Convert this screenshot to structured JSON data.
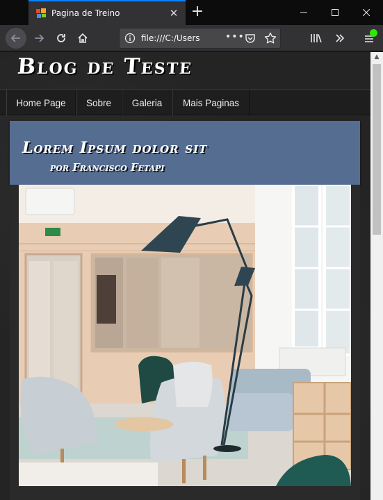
{
  "browser": {
    "tab_title": "Pagina de Treino",
    "url": "file:///C:/Users",
    "url_more": "•••",
    "new_tab": "+",
    "tab_close": "✕"
  },
  "blog": {
    "title": "Blog de Teste",
    "nav": [
      "Home Page",
      "Sobre",
      "Galeria",
      "Mais Paginas"
    ]
  },
  "post": {
    "title": "Lorem Ipsum dolor sit",
    "author": "por Francisco Fetapi"
  },
  "colors": {
    "tab_accent": "#0a84ff",
    "post_header": "#556d91",
    "page_bg": "#242424",
    "menu_badge": "#30e60b"
  },
  "icons": {
    "back": "back-arrow-icon",
    "forward": "forward-arrow-icon",
    "reload": "reload-icon",
    "home": "home-icon",
    "info": "info-icon",
    "pocket": "pocket-icon",
    "bookmark": "star-icon",
    "library": "library-icon",
    "overflow": "chevron-double-right-icon",
    "menu": "hamburger-menu-icon"
  }
}
